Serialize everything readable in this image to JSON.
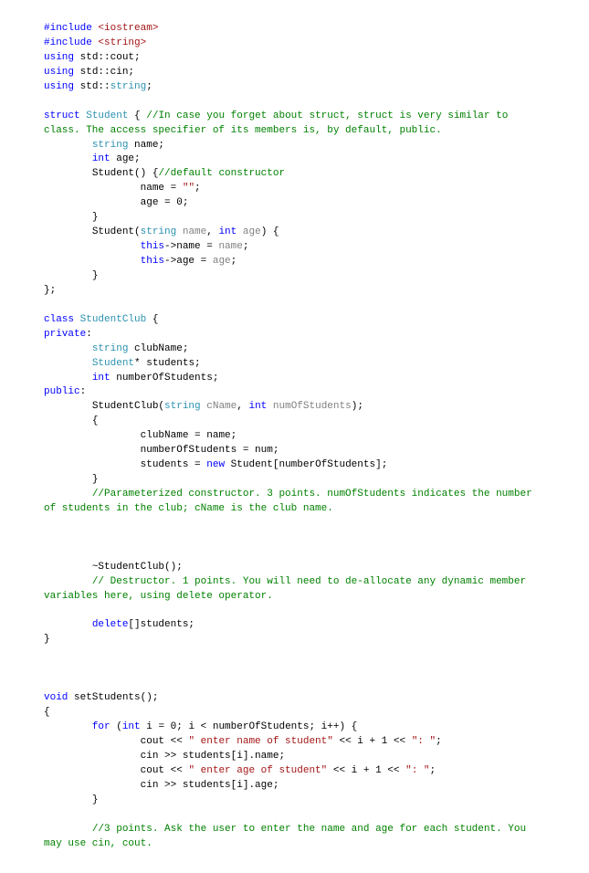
{
  "line1": {
    "inc": "#include",
    "hdr": "<iostream>"
  },
  "line2": {
    "inc": "#include",
    "hdr": "<string>"
  },
  "line3": {
    "u": "using",
    "ns": " std::cout;"
  },
  "line4": {
    "u": "using",
    "ns": " std::cin;"
  },
  "line5": {
    "u": "using",
    "ns1": " std::",
    "t": "string",
    "ns2": ";"
  },
  "blank": "",
  "struct1": {
    "kw": "struct",
    "sp": " ",
    "name": "Student",
    "rest": " { ",
    "cmt": "//In case you forget about struct, struct is very similar to class. The access specifier of its members is, by default, public."
  },
  "struct2": {
    "pad": "        ",
    "t": "string",
    "rest": " name;"
  },
  "struct3": {
    "pad": "        ",
    "kw": "int",
    "rest": " age;"
  },
  "struct4": {
    "pad": "        Student() {",
    "cmt": "//default constructor"
  },
  "struct5": "                name = ",
  "struct5s": "\"\"",
  "struct5e": ";",
  "struct6": "                age = 0;",
  "struct7": "        }",
  "struct8a": "        Student(",
  "struct8b": "string",
  "struct8c": " ",
  "struct8d": "name",
  "struct8e": ", ",
  "struct8f": "int",
  "struct8g": " ",
  "struct8h": "age",
  "struct8i": ") {",
  "struct9a": "                ",
  "struct9b": "this",
  "struct9c": "->name = ",
  "struct9d": "name",
  "struct9e": ";",
  "struct10a": "                ",
  "struct10b": "this",
  "struct10c": "->age = ",
  "struct10d": "age",
  "struct10e": ";",
  "struct11": "        }",
  "struct12": "};",
  "class1a": "class",
  "class1b": " ",
  "class1c": "StudentClub",
  "class1d": " {",
  "class2a": "private",
  "class2b": ":",
  "class3a": "        ",
  "class3b": "string",
  "class3c": " clubName;",
  "class4a": "        ",
  "class4b": "Student",
  "class4c": "* students;",
  "class5a": "        ",
  "class5b": "int",
  "class5c": " numberOfStudents;",
  "class6a": "public",
  "class6b": ":",
  "ctor1a": "        StudentClub(",
  "ctor1b": "string",
  "ctor1c": " ",
  "ctor1d": "cName",
  "ctor1e": ", ",
  "ctor1f": "int",
  "ctor1g": " ",
  "ctor1h": "numOfStudents",
  "ctor1i": ");",
  "ctor2": "        {",
  "ctor3": "                clubName = name;",
  "ctor4": "                numberOfStudents = num;",
  "ctor5a": "                students = ",
  "ctor5b": "new",
  "ctor5c": " Student[numberOfStudents];",
  "ctor6": "        }",
  "ctorcmt": "        //Parameterized constructor. 3 points. numOfStudents indicates the number of students in the club; cName is the club name.",
  "dtor1": "        ~StudentClub();",
  "dtorcmt": "        // Destructor. 1 points. You will need to de-allocate any dynamic member variables here, using delete operator.",
  "del1a": "        ",
  "del1b": "delete",
  "del1c": "[]students;",
  "close1": "}",
  "set1a": "void",
  "set1b": " setStudents();",
  "set2": "{",
  "for1a": "        ",
  "for1b": "for",
  "for1c": " (",
  "for1d": "int",
  "for1e": " i = 0; i < numberOfStudents; i++) {",
  "for2a": "                cout << ",
  "for2b": "\" enter name of student\"",
  "for2c": " << i + 1 << ",
  "for2d": "\": \"",
  "for2e": ";",
  "for3": "                cin >> students[i].name;",
  "for4a": "                cout << ",
  "for4b": "\" enter age of student\"",
  "for4c": " << i + 1 << ",
  "for4d": "\": \"",
  "for4e": ";",
  "for5": "                cin >> students[i].age;",
  "for6": "        }",
  "setcmt": "        //3 points. Ask the user to enter the name and age for each student. You may use cin, cout."
}
